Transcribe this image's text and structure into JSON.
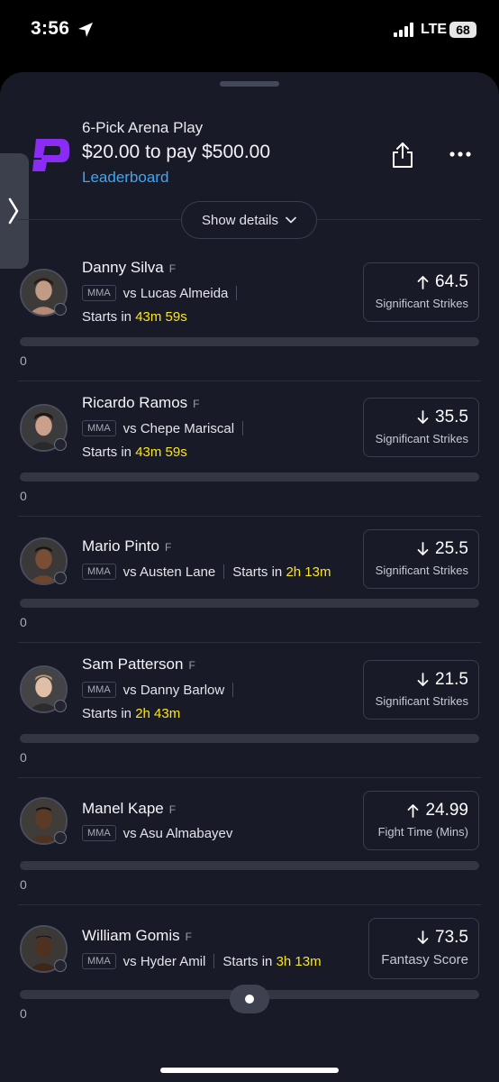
{
  "status": {
    "time": "3:56",
    "network": "LTE",
    "battery": "68"
  },
  "entry": {
    "title": "6-Pick Arena Play",
    "payout": "$20.00 to pay $500.00",
    "leaderboard_label": "Leaderboard",
    "show_details_label": "Show details"
  },
  "colors": {
    "background": "#181a27",
    "accent_blue": "#3da6f5",
    "highlight_yellow": "#fce51d",
    "brand_purple": "#8b2cf5"
  },
  "picks": [
    {
      "name": "Danny Silva",
      "position": "F",
      "league": "MMA",
      "opponent": "vs Lucas Almeida",
      "starts_label": "Starts in",
      "starts_time": "43m 59s",
      "direction": "up",
      "line": "64.5",
      "stat": "Significant Strikes",
      "progress": "0"
    },
    {
      "name": "Ricardo Ramos",
      "position": "F",
      "league": "MMA",
      "opponent": "vs Chepe Mariscal",
      "starts_label": "Starts in",
      "starts_time": "43m 59s",
      "direction": "down",
      "line": "35.5",
      "stat": "Significant Strikes",
      "progress": "0"
    },
    {
      "name": "Mario Pinto",
      "position": "F",
      "league": "MMA",
      "opponent": "vs Austen Lane",
      "starts_label": "Starts in",
      "starts_time": "2h 13m",
      "direction": "down",
      "line": "25.5",
      "stat": "Significant Strikes",
      "progress": "0"
    },
    {
      "name": "Sam Patterson",
      "position": "F",
      "league": "MMA",
      "opponent": "vs Danny Barlow",
      "starts_label": "Starts in",
      "starts_time": "2h 43m",
      "direction": "down",
      "line": "21.5",
      "stat": "Significant Strikes",
      "progress": "0"
    },
    {
      "name": "Manel Kape",
      "position": "F",
      "league": "MMA",
      "opponent": "vs Asu Almabayev",
      "starts_label": "",
      "starts_time": "",
      "direction": "up",
      "line": "24.99",
      "stat": "Fight Time (Mins)",
      "progress": "0"
    },
    {
      "name": "William Gomis",
      "position": "F",
      "league": "MMA",
      "opponent": "vs Hyder Amil",
      "starts_label": "Starts in",
      "starts_time": "3h 13m",
      "direction": "down",
      "line": "73.5",
      "stat": "Fantasy Score",
      "progress": "0"
    }
  ]
}
